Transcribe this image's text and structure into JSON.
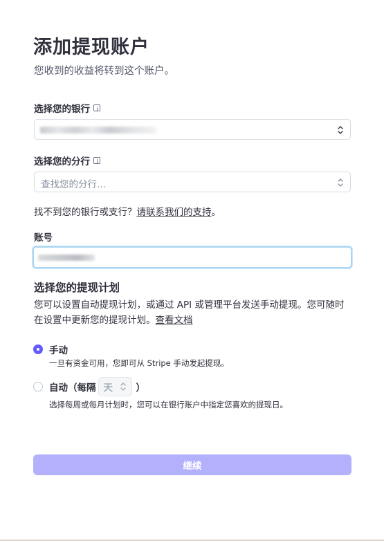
{
  "header": {
    "title": "添加提现账户",
    "subtitle": "您收到的收益将转到这个账户。"
  },
  "bank": {
    "label": "选择您的银行"
  },
  "branch": {
    "label": "选择您的分行",
    "placeholder": "查找您的分行..."
  },
  "help": {
    "text": "找不到您的银行或支行？",
    "link": "请联系我们的支持",
    "suffix": "。"
  },
  "account": {
    "label": "账号"
  },
  "schedule": {
    "title": "选择您的提现计划",
    "description": "您可以设置自动提现计划，或通过 API 或管理平台发送手动提现。您可随时在设置中更新您的提现计划。",
    "docs_link": "查看文档",
    "options": [
      {
        "label": "手动",
        "description": "一旦有资金可用，您即可从 Stripe 手动发起提现。",
        "selected": true
      },
      {
        "label_prefix": "自动（每隔",
        "interval": "天",
        "label_suffix": "）",
        "description": "选择每周或每月计划时，您可以在银行账户中指定您喜欢的提现日。",
        "selected": false
      }
    ]
  },
  "actions": {
    "continue_label": "继续"
  },
  "colors": {
    "accent": "#635bff",
    "button_disabled": "#b3b0fc",
    "focus_ring": "#a9d6f2"
  }
}
